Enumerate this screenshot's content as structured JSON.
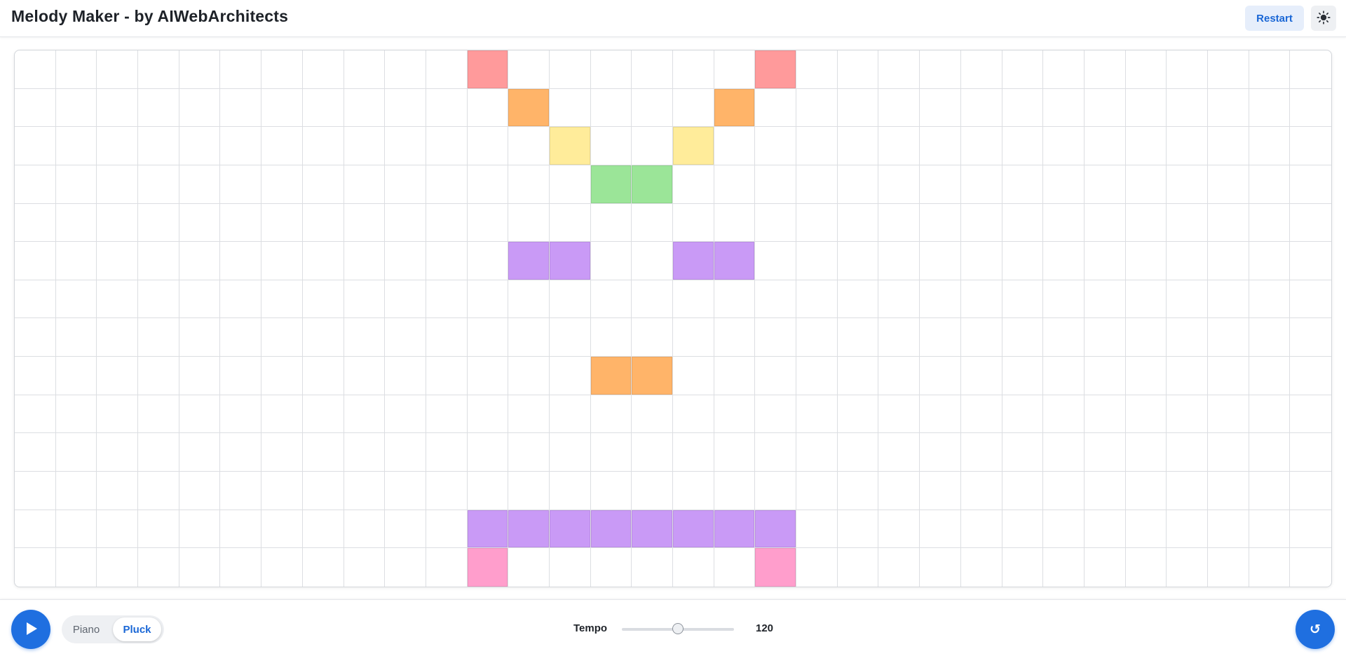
{
  "header": {
    "title": "Melody Maker - by AIWebArchitects",
    "restart_label": "Restart",
    "theme_icon": "sun-icon"
  },
  "grid": {
    "columns": 32,
    "rows": 14,
    "row_colors": [
      "#ff9a9b",
      "#ffb469",
      "#ffec9a",
      "#9be598",
      "#9be598",
      "#c99af6",
      "#c99af6",
      "#c99af6",
      "#ffb469",
      "#ffb469",
      "#ffec9a",
      "#ffec9a",
      "#c99af6",
      "#ff9ecc"
    ],
    "active_cells": [
      [
        0,
        11
      ],
      [
        0,
        18
      ],
      [
        1,
        12
      ],
      [
        1,
        17
      ],
      [
        2,
        13
      ],
      [
        2,
        16
      ],
      [
        3,
        14
      ],
      [
        3,
        15
      ],
      [
        5,
        12
      ],
      [
        5,
        13
      ],
      [
        5,
        16
      ],
      [
        5,
        17
      ],
      [
        8,
        14
      ],
      [
        8,
        15
      ],
      [
        12,
        11
      ],
      [
        12,
        12
      ],
      [
        12,
        13
      ],
      [
        12,
        14
      ],
      [
        12,
        15
      ],
      [
        12,
        16
      ],
      [
        12,
        17
      ],
      [
        12,
        18
      ],
      [
        13,
        11
      ],
      [
        13,
        18
      ]
    ]
  },
  "controls": {
    "play_icon": "play-icon",
    "instruments": [
      {
        "label": "Piano",
        "selected": false
      },
      {
        "label": "Pluck",
        "selected": true
      }
    ],
    "tempo_label": "Tempo",
    "tempo_value": "120",
    "tempo_fraction": 0.5,
    "reset_icon": "reset-icon",
    "reset_glyph": "↺"
  },
  "colors": {
    "accent": "#1f6fe0"
  }
}
